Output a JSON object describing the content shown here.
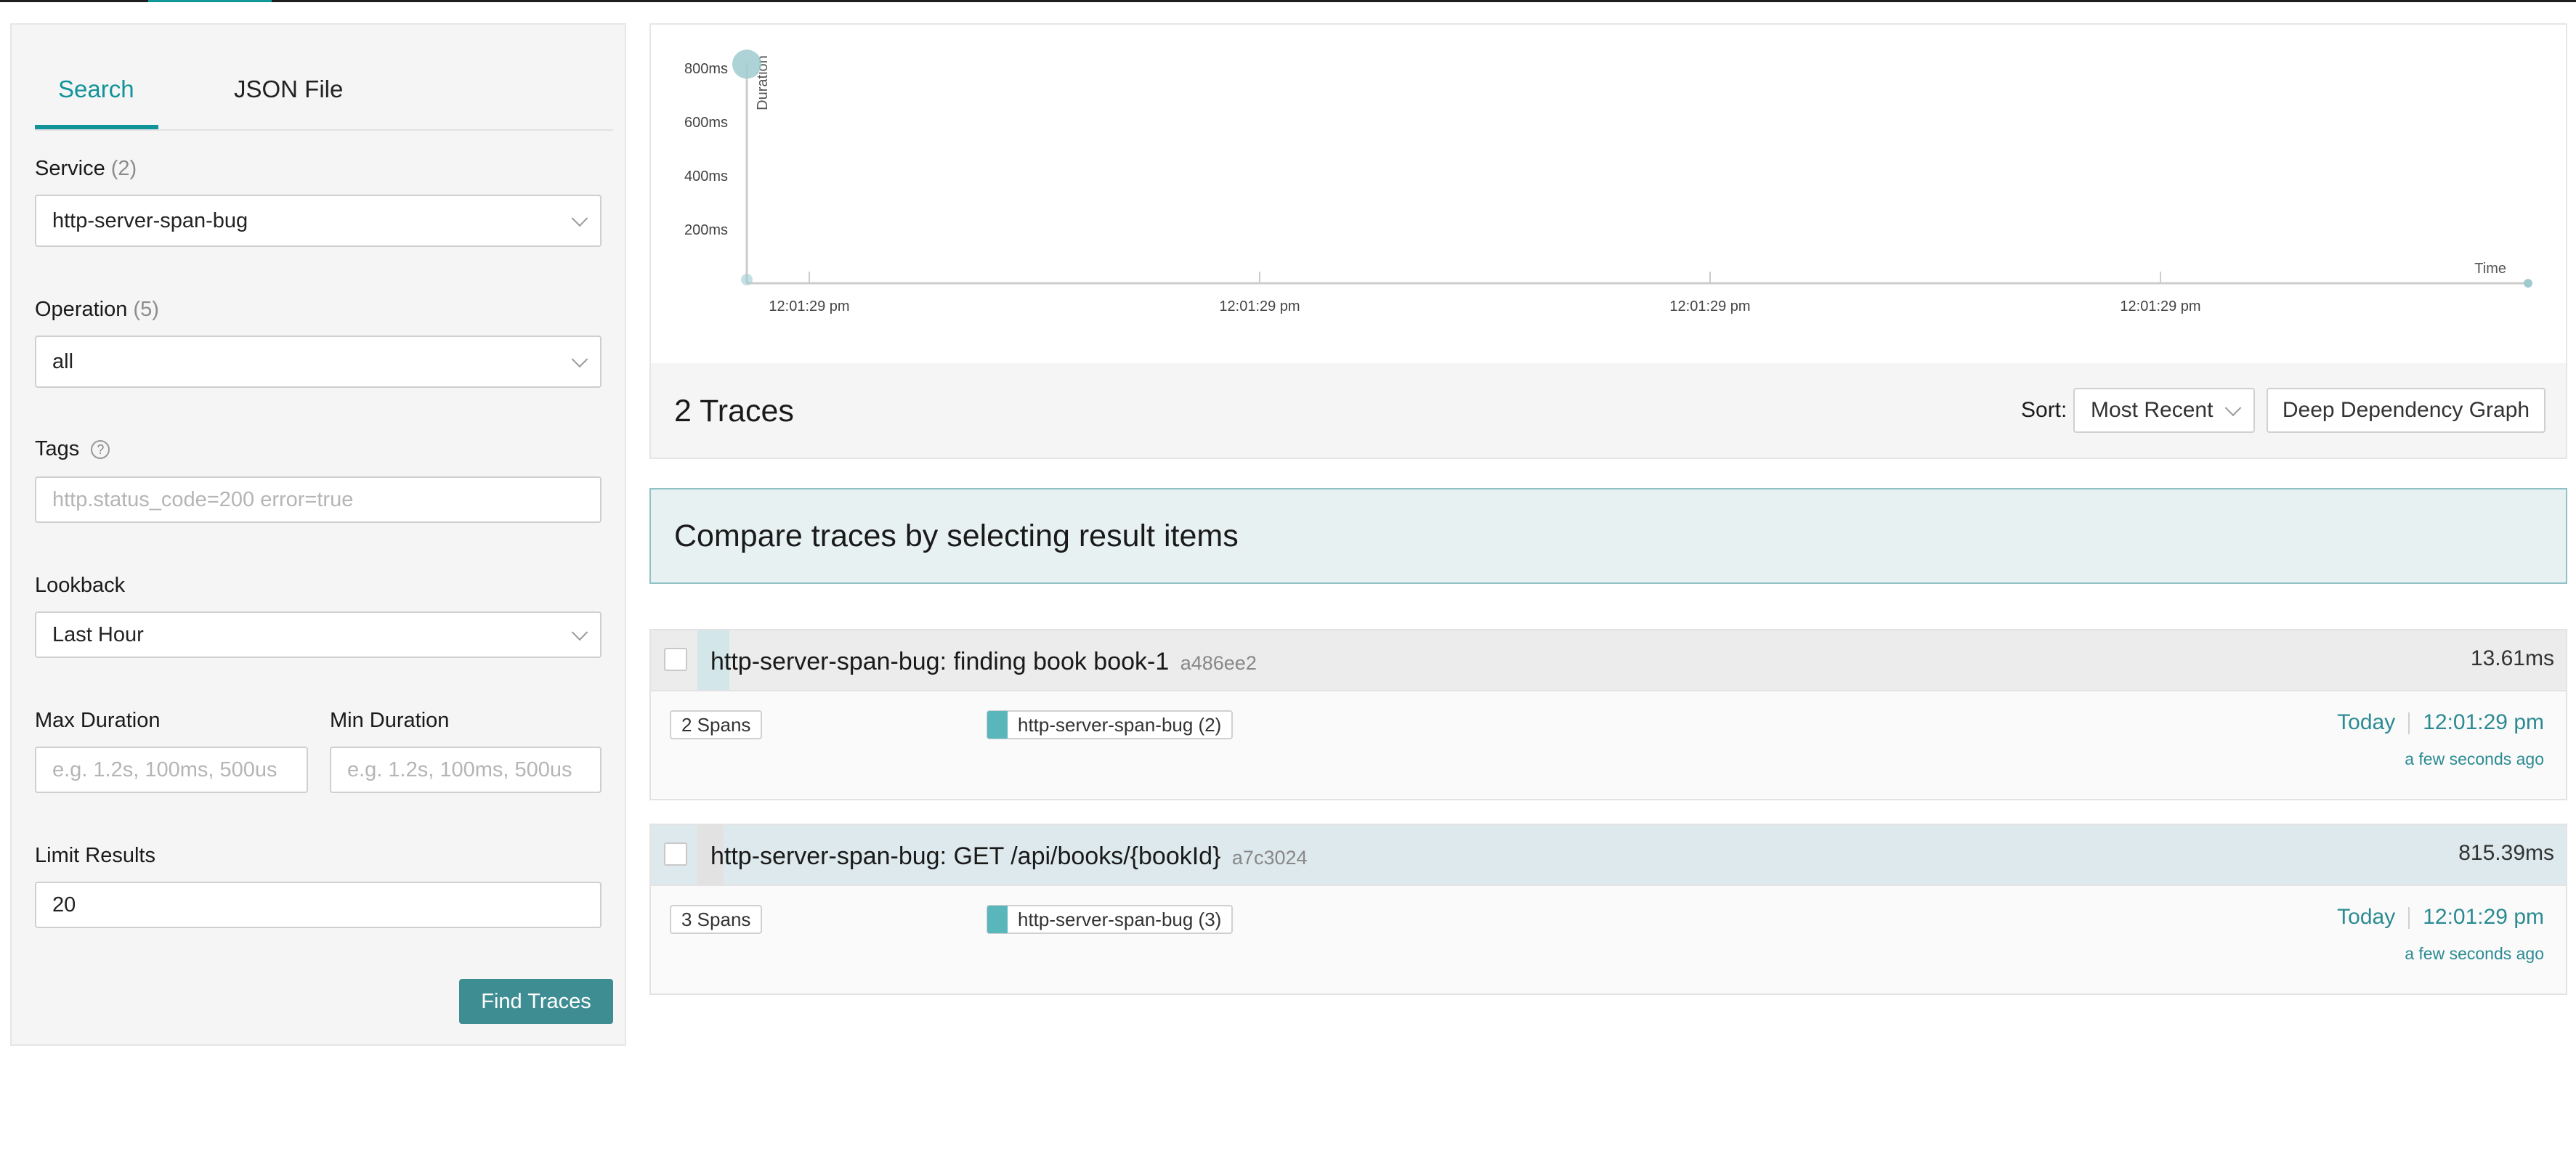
{
  "sidebar": {
    "tabs": [
      {
        "label": "Search"
      },
      {
        "label": "JSON File"
      }
    ],
    "service": {
      "label": "Service",
      "count": "(2)",
      "value": "http-server-span-bug"
    },
    "operation": {
      "label": "Operation",
      "count": "(5)",
      "value": "all"
    },
    "tags": {
      "label": "Tags",
      "help": "?",
      "placeholder": "http.status_code=200 error=true"
    },
    "lookback": {
      "label": "Lookback",
      "value": "Last Hour"
    },
    "max_duration": {
      "label": "Max Duration",
      "placeholder": "e.g. 1.2s, 100ms, 500us"
    },
    "min_duration": {
      "label": "Min Duration",
      "placeholder": "e.g. 1.2s, 100ms, 500us"
    },
    "limit": {
      "label": "Limit Results",
      "value": "20"
    },
    "find_button": "Find Traces"
  },
  "chart_data": {
    "type": "scatter",
    "y_ticks": [
      "800ms",
      "600ms",
      "400ms",
      "200ms"
    ],
    "x_ticks": [
      "12:01:29 pm",
      "12:01:29 pm",
      "12:01:29 pm",
      "12:01:29 pm"
    ],
    "ylabel": "Duration",
    "xlabel": "Time",
    "series": [
      {
        "points": [
          {
            "x": "12:01:29 pm",
            "y": 815.39
          },
          {
            "x": "12:01:29 pm",
            "y": 13.61
          }
        ]
      }
    ],
    "colors": {
      "point": "#9fcbd0",
      "axis": "#cccccc"
    }
  },
  "results": {
    "title": "2 Traces",
    "sort_label": "Sort:",
    "sort_value": "Most Recent",
    "ddg_button": "Deep Dependency Graph",
    "compare_banner": "Compare traces by selecting result items"
  },
  "traces": [
    {
      "name": "http-server-span-bug: finding book book-1",
      "id": "a486ee2",
      "duration": "13.61ms",
      "spans": "2 Spans",
      "service": "http-server-span-bug (2)",
      "day": "Today",
      "time": "12:01:29 pm",
      "ago": "a few seconds ago"
    },
    {
      "name": "http-server-span-bug: GET /api/books/{bookId}",
      "id": "a7c3024",
      "duration": "815.39ms",
      "spans": "3 Spans",
      "service": "http-server-span-bug (3)",
      "day": "Today",
      "time": "12:01:29 pm",
      "ago": "a few seconds ago"
    }
  ]
}
